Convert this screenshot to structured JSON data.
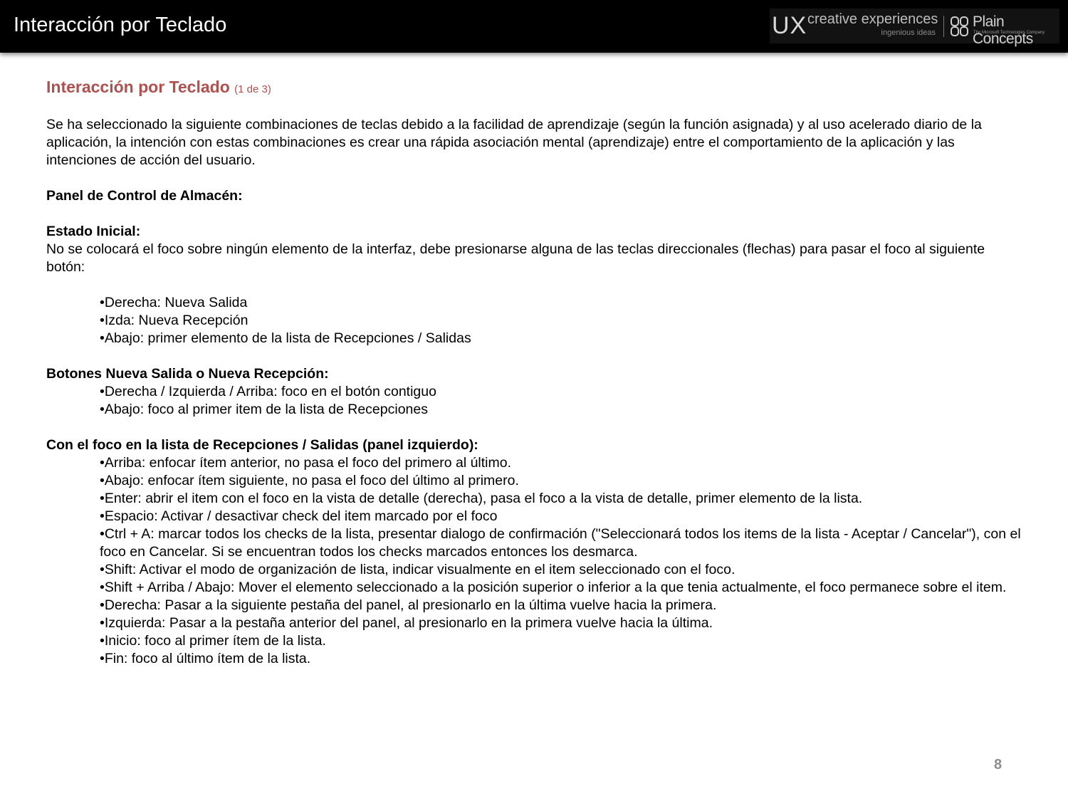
{
  "header": {
    "title": "Interacción por Teclado",
    "logo": {
      "ux": "UX",
      "creative": "creative experiences",
      "ingenious": "ingenious ideas",
      "plain_concepts": "Plain Concepts",
      "tagline": "The Microsoft Technologies Company"
    }
  },
  "content": {
    "section_title": "Interacción por Teclado",
    "section_sub": "(1 de 3)",
    "intro": "Se ha seleccionado la siguiente combinaciones de teclas debido a la facilidad de aprendizaje (según la función asignada) y al uso acelerado diario de la aplicación, la intención con estas combinaciones es crear una rápida asociación mental (aprendizaje) entre el comportamiento de la aplicación y las intenciones de acción del usuario.",
    "panel_heading": "Panel de Control de Almacén:",
    "estado_heading": "Estado Inicial:",
    "estado_text": "No se colocará el foco sobre ningún elemento de la interfaz, debe presionarse alguna de las teclas direccionales (flechas) para pasar el foco al siguiente botón:",
    "estado_items": [
      "•Derecha: Nueva Salida",
      "•Izda: Nueva Recepción",
      "•Abajo: primer elemento de la lista de Recepciones / Salidas"
    ],
    "botones_heading": "Botones Nueva Salida o Nueva Recepción:",
    "botones_items": [
      "•Derecha / Izquierda / Arriba: foco en el botón contiguo",
      "•Abajo: foco al primer item de la lista de Recepciones"
    ],
    "lista_heading": "Con el foco en la lista de Recepciones / Salidas (panel izquierdo):",
    "lista_items": [
      "•Arriba: enfocar ítem anterior, no pasa el foco del primero al último.",
      "•Abajo: enfocar ítem siguiente, no pasa el foco del último al primero.",
      "•Enter: abrir el item con el foco en la vista de detalle (derecha), pasa el foco a la vista de detalle, primer elemento de la lista.",
      "•Espacio: Activar / desactivar check del item marcado por el foco",
      "•Ctrl + A: marcar todos los checks de la lista, presentar dialogo de confirmación (\"Seleccionará todos los items de la lista - Aceptar / Cancelar\"), con el foco en Cancelar. Si se encuentran todos los checks marcados entonces los desmarca.",
      "•Shift: Activar el modo de organización de lista, indicar visualmente en el item seleccionado con el foco.",
      "•Shift + Arriba / Abajo: Mover el elemento seleccionado a la posición superior o inferior a la que tenia actualmente, el foco permanece sobre el item.",
      "•Derecha: Pasar a la siguiente pestaña del panel, al presionarlo en la última vuelve hacia la primera.",
      "•Izquierda: Pasar a la pestaña anterior del panel, al presionarlo en la primera vuelve hacia la última.",
      "•Inicio: foco al primer ítem de la lista.",
      "•Fin: foco al último ítem de la lista."
    ]
  },
  "footer": {
    "page_number": "8"
  },
  "colors": {
    "header_bg": "#000000",
    "title_accent": "#b0504f",
    "page_number": "#8c8c8c"
  }
}
